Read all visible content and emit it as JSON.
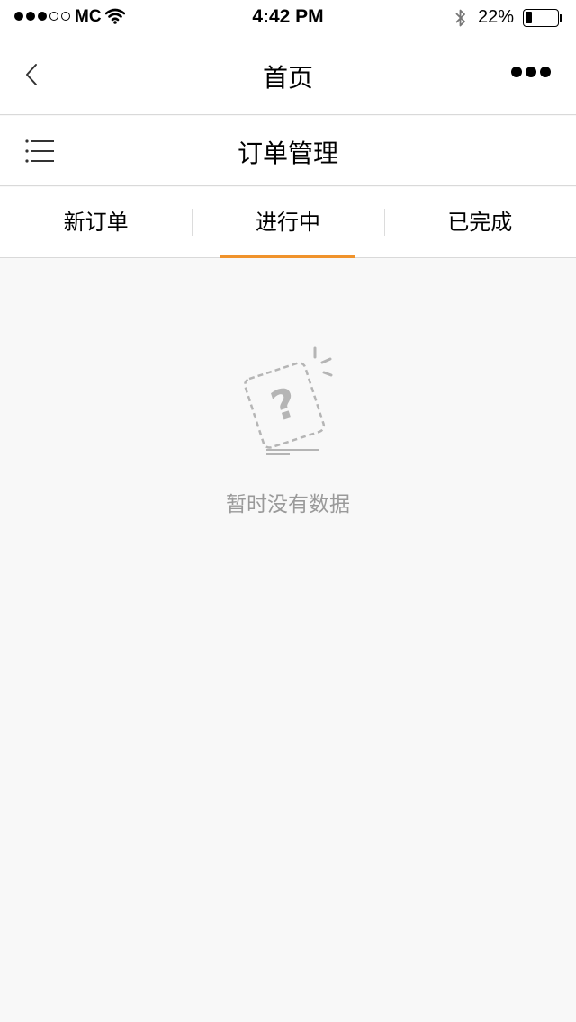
{
  "status_bar": {
    "carrier": "MC",
    "time": "4:42 PM",
    "battery_text": "22%",
    "battery_level": 0.22,
    "signal_bars_filled": 3,
    "signal_bars_total": 5
  },
  "nav_bar": {
    "title": "首页",
    "back_icon": "chevron-left-icon",
    "more_icon": "more-dots-icon"
  },
  "section": {
    "title": "订单管理",
    "menu_icon": "list-menu-icon"
  },
  "tabs": [
    {
      "label": "新订单",
      "active": false
    },
    {
      "label": "进行中",
      "active": true
    },
    {
      "label": "已完成",
      "active": false
    }
  ],
  "empty_state": {
    "icon": "question-card-icon",
    "message": "暂时没有数据"
  },
  "colors": {
    "accent": "#f0932b",
    "background": "#f8f8f8",
    "muted_text": "#9a9a9a"
  }
}
